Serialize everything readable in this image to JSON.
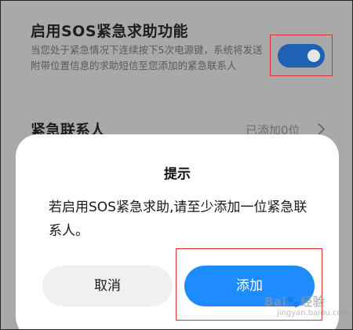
{
  "sos_setting": {
    "title": "启用SOS紧急求助功能",
    "description": "当您处于紧急情况下连续按下5次电源键，系统将发送附带位置信息的求助短信至您添加的紧急联系人",
    "toggle_on": true,
    "toggle_color": "#1f61b3"
  },
  "emergency_contacts": {
    "label": "紧急联系人",
    "value": "已添加0位"
  },
  "dialog": {
    "title": "提示",
    "message": "若启用SOS紧急求助,请至少添加一位紧急联系人。",
    "cancel_label": "取消",
    "add_label": "添加",
    "add_color": "#1e8cff"
  },
  "watermark": {
    "brand": "Bai",
    "brand_suffix": "经验",
    "sub": "jingyan.baidu.com"
  }
}
